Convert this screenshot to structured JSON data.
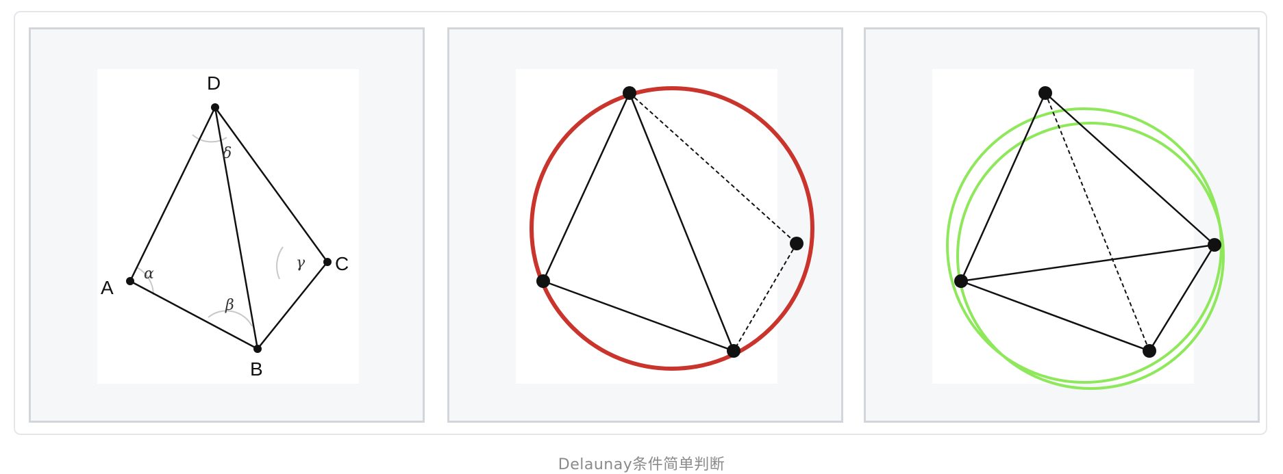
{
  "caption": "Delaunay条件简单判断",
  "panel1": {
    "point_labels": {
      "A": "A",
      "B": "B",
      "C": "C",
      "D": "D"
    },
    "angle_labels": {
      "alpha": "α",
      "beta": "β",
      "gamma": "γ",
      "delta": "δ"
    }
  },
  "colors": {
    "edge": "#111111",
    "angle_arc": "#c8c8c8",
    "circumcircle_invalid": "#c9352c",
    "circumcircle_valid": "#8fe85c",
    "panel_bg": "#f6f7f9",
    "panel_border": "#d2d5da"
  }
}
